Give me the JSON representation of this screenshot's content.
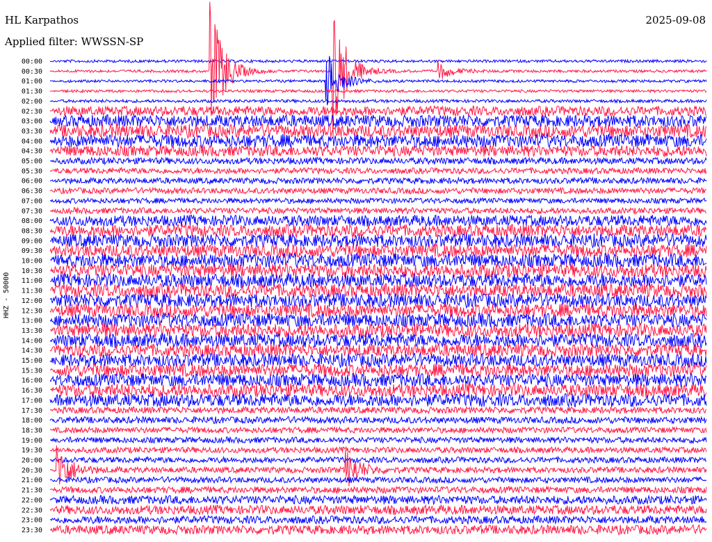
{
  "header": {
    "station": "HL Karpathos",
    "date": "2025-09-08",
    "filter": "Applied filter: WWSSN-SP",
    "channel": "HHZ - 50000"
  },
  "colors": {
    "blue": "#0000ff",
    "red": "#ff1744"
  },
  "chart_data": {
    "type": "line",
    "title": "",
    "xlabel": "",
    "ylabel": "HHZ - 50000",
    "row_labels": [
      "00:00",
      "00:30",
      "01:00",
      "01:30",
      "02:00",
      "02:30",
      "03:00",
      "03:30",
      "04:00",
      "04:30",
      "05:00",
      "05:30",
      "06:00",
      "06:30",
      "07:00",
      "07:30",
      "08:00",
      "08:30",
      "09:00",
      "09:30",
      "10:00",
      "10:30",
      "11:00",
      "11:30",
      "12:00",
      "12:30",
      "13:00",
      "13:30",
      "14:00",
      "14:30",
      "15:00",
      "15:30",
      "16:00",
      "16:30",
      "17:00",
      "17:30",
      "18:00",
      "18:30",
      "19:00",
      "19:30",
      "20:00",
      "20:30",
      "21:00",
      "21:30",
      "22:00",
      "22:30",
      "23:00",
      "23:30"
    ],
    "row_minutes": 30,
    "alternating_colors": [
      "blue",
      "red"
    ],
    "noise_level_by_row": [
      0.05,
      0.05,
      0.05,
      0.05,
      0.08,
      0.6,
      0.8,
      0.85,
      0.85,
      0.7,
      0.35,
      0.3,
      0.3,
      0.3,
      0.25,
      0.3,
      0.7,
      0.8,
      0.85,
      0.85,
      0.9,
      0.9,
      0.9,
      0.9,
      0.9,
      0.9,
      0.9,
      0.9,
      0.9,
      0.85,
      0.85,
      0.85,
      0.85,
      0.85,
      0.85,
      0.35,
      0.35,
      0.3,
      0.3,
      0.3,
      0.3,
      0.3,
      0.3,
      0.35,
      0.5,
      0.55,
      0.45,
      0.55
    ],
    "events": [
      {
        "row": 1,
        "minute": 7.3,
        "amplitude": 9
      },
      {
        "row": 1,
        "minute": 12.9,
        "amplitude": 9
      },
      {
        "row": 2,
        "minute": 12.6,
        "amplitude": 4
      },
      {
        "row": 1,
        "minute": 17.7,
        "amplitude": 1.2
      },
      {
        "row": 41,
        "minute": 0.3,
        "amplitude": 3
      },
      {
        "row": 41,
        "minute": 13.5,
        "amplitude": 2.5
      }
    ]
  }
}
